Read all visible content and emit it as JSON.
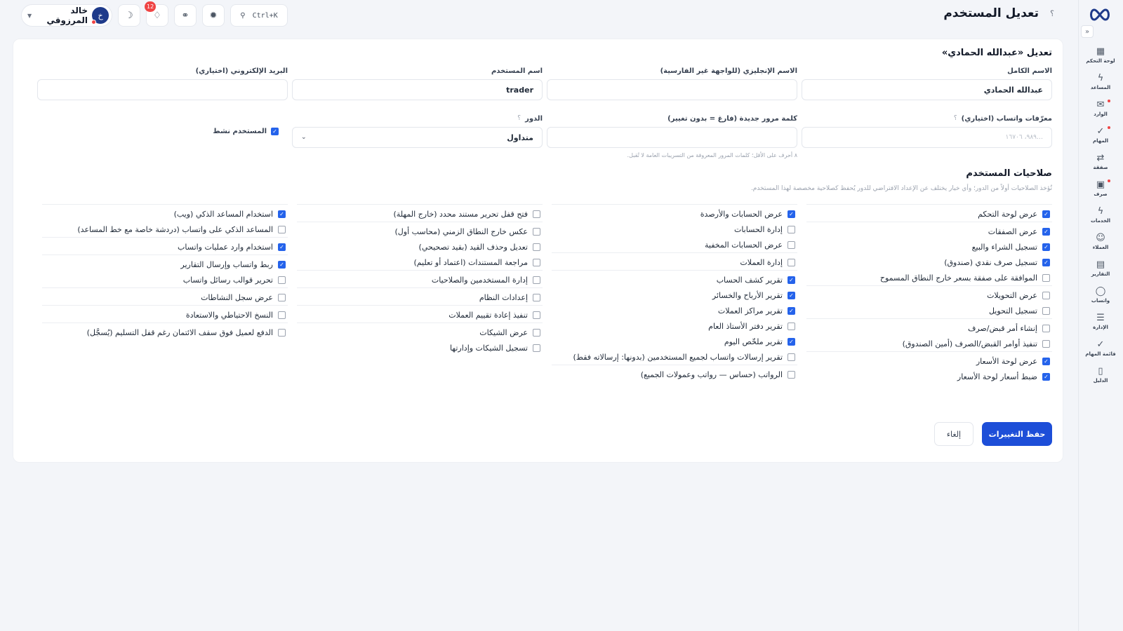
{
  "header": {
    "page_title": "تعديل المستخدم",
    "title_help": "؟",
    "search_shortcut": "Ctrl+K",
    "notifications_count": "12",
    "user_name": "خالد المرزوقي",
    "user_initial": "خ"
  },
  "sidebar": {
    "collapse": "«",
    "items": [
      {
        "label": "لوحة التحكم",
        "icon": "dashboard-icon",
        "glyph": "▦"
      },
      {
        "label": "المساعد",
        "icon": "bolt-icon",
        "glyph": "ϟ"
      },
      {
        "label": "الوارد",
        "icon": "inbox-icon",
        "glyph": "✉"
      },
      {
        "label": "المهام",
        "icon": "check-icon",
        "glyph": "✓"
      },
      {
        "label": "صفقة",
        "icon": "exchange-icon",
        "glyph": "⇄"
      },
      {
        "label": "صرف",
        "icon": "cash-icon",
        "glyph": "▣"
      },
      {
        "label": "الخدمات",
        "icon": "bolt-icon",
        "glyph": "ϟ"
      },
      {
        "label": "العملاء",
        "icon": "users-icon",
        "glyph": "☺"
      },
      {
        "label": "التقارير",
        "icon": "report-icon",
        "glyph": "▤"
      },
      {
        "label": "واتساب",
        "icon": "chat-icon",
        "glyph": "◯"
      },
      {
        "label": "الإدارة",
        "icon": "sliders-icon",
        "glyph": "☰"
      },
      {
        "label": "قائمة المهام",
        "icon": "checklist-icon",
        "glyph": "✓"
      },
      {
        "label": "الدليل",
        "icon": "book-icon",
        "glyph": "▯"
      }
    ]
  },
  "form": {
    "card_title": "تعديل «عبدالله الحمادي»",
    "full_name_label": "الاسم الكامل",
    "full_name_value": "عبدالله الحمادي",
    "english_name_label": "الاسم الإنجليزي (للواجهة غير الفارسية)",
    "english_name_value": "",
    "username_label": "اسم المستخدم",
    "username_value": "trader",
    "email_label": "البريد الإلكتروني (اختياري)",
    "email_value": "",
    "whatsapp_label": "معرّفات واتساب (اختياري)",
    "whatsapp_help": "؟",
    "whatsapp_placeholder": "…٩٨٩، ١٦٧٠٦",
    "password_label": "كلمة مرور جديدة (فارغ = بدون تغيير)",
    "password_hint": "٨ أحرف على الأقل؛ كلمات المرور المعروفة من التسريبات العامة لا تُقبل.",
    "role_label": "الدور",
    "role_help": "؟",
    "role_value": "متداول",
    "active_label": "المستخدم نشط",
    "active_checked": true
  },
  "permissions": {
    "title": "صلاحيات المستخدم",
    "description": "تُؤخذ الصلاحيات أولاً من الدور؛ وأي خيار يختلف عن الإعداد الافتراضي للدور يُحفظ كصلاحية مخصصة لهذا المستخدم.",
    "columns": [
      [
        [
          {
            "label": "عرض لوحة التحكم",
            "checked": true
          }
        ],
        [
          {
            "label": "عرض الصفقات",
            "checked": true
          },
          {
            "label": "تسجيل الشراء والبيع",
            "checked": true
          },
          {
            "label": "تسجيل صرف نقدي (صندوق)",
            "checked": true
          },
          {
            "label": "الموافقة على صفقة بسعر خارج النطاق المسموح",
            "checked": false
          }
        ],
        [
          {
            "label": "عرض التحويلات",
            "checked": false
          },
          {
            "label": "تسجيل التحويل",
            "checked": false
          }
        ],
        [
          {
            "label": "إنشاء أمر قبض/صرف",
            "checked": false
          },
          {
            "label": "تنفيذ أوامر القبض/الصرف (أمين الصندوق)",
            "checked": false
          }
        ],
        [
          {
            "label": "عرض لوحة الأسعار",
            "checked": true
          },
          {
            "label": "ضبط أسعار لوحة الأسعار",
            "checked": true
          }
        ]
      ],
      [
        [
          {
            "label": "عرض الحسابات والأرصدة",
            "checked": true
          },
          {
            "label": "إدارة الحسابات",
            "checked": false
          },
          {
            "label": "عرض الحسابات المخفية",
            "checked": false
          }
        ],
        [
          {
            "label": "إدارة العملات",
            "checked": false
          }
        ],
        [
          {
            "label": "تقرير كشف الحساب",
            "checked": true
          },
          {
            "label": "تقرير الأرباح والخسائر",
            "checked": true
          },
          {
            "label": "تقرير مراكز العملات",
            "checked": true
          },
          {
            "label": "تقرير دفتر الأستاذ العام",
            "checked": false
          },
          {
            "label": "تقرير ملخّص اليوم",
            "checked": true
          },
          {
            "label": "تقرير إرسالات واتساب لجميع المستخدمين (بدونها: إرسالاته فقط)",
            "checked": false
          }
        ],
        [
          {
            "label": "الرواتب (حساس — رواتب وعمولات الجميع)",
            "checked": false
          }
        ]
      ],
      [
        [
          {
            "label": "فتح قفل تحرير مستند محدد (خارج المهلة)",
            "checked": false
          }
        ],
        [
          {
            "label": "عكس خارج النطاق الزمني (محاسب أول)",
            "checked": false
          },
          {
            "label": "تعديل وحذف القيد (بقيد تصحيحي)",
            "checked": false
          },
          {
            "label": "مراجعة المستندات (اعتماد أو تعليم)",
            "checked": false
          }
        ],
        [
          {
            "label": "إدارة المستخدمين والصلاحيات",
            "checked": false
          }
        ],
        [
          {
            "label": "إعدادات النظام",
            "checked": false
          }
        ],
        [
          {
            "label": "تنفيذ إعادة تقييم العملات",
            "checked": false
          }
        ],
        [
          {
            "label": "عرض الشيكات",
            "checked": false
          },
          {
            "label": "تسجيل الشيكات وإدارتها",
            "checked": false
          }
        ]
      ],
      [
        [
          {
            "label": "استخدام المساعد الذكي (ويب)",
            "checked": true
          },
          {
            "label": "المساعد الذكي على واتساب (دردشة خاصة مع خط المساعد)",
            "checked": false
          }
        ],
        [
          {
            "label": "استخدام وارد عمليات واتساب",
            "checked": true
          }
        ],
        [
          {
            "label": "ربط واتساب وإرسال التقارير",
            "checked": true
          },
          {
            "label": "تحرير قوالب رسائل واتساب",
            "checked": false
          }
        ],
        [
          {
            "label": "عرض سجل النشاطات",
            "checked": false
          }
        ],
        [
          {
            "label": "النسخ الاحتياطي والاستعادة",
            "checked": false
          }
        ],
        [
          {
            "label": "الدفع لعميل فوق سقف الائتمان رغم قفل التسليم (يُسجَّل)",
            "checked": false
          }
        ]
      ]
    ]
  },
  "actions": {
    "save_label": "حفظ التغييرات",
    "cancel_label": "إلغاء"
  },
  "colors": {
    "primary": "#1d4ed8",
    "checkbox": "#2563eb",
    "badge": "#ef4444",
    "background": "#f3f5f9"
  }
}
